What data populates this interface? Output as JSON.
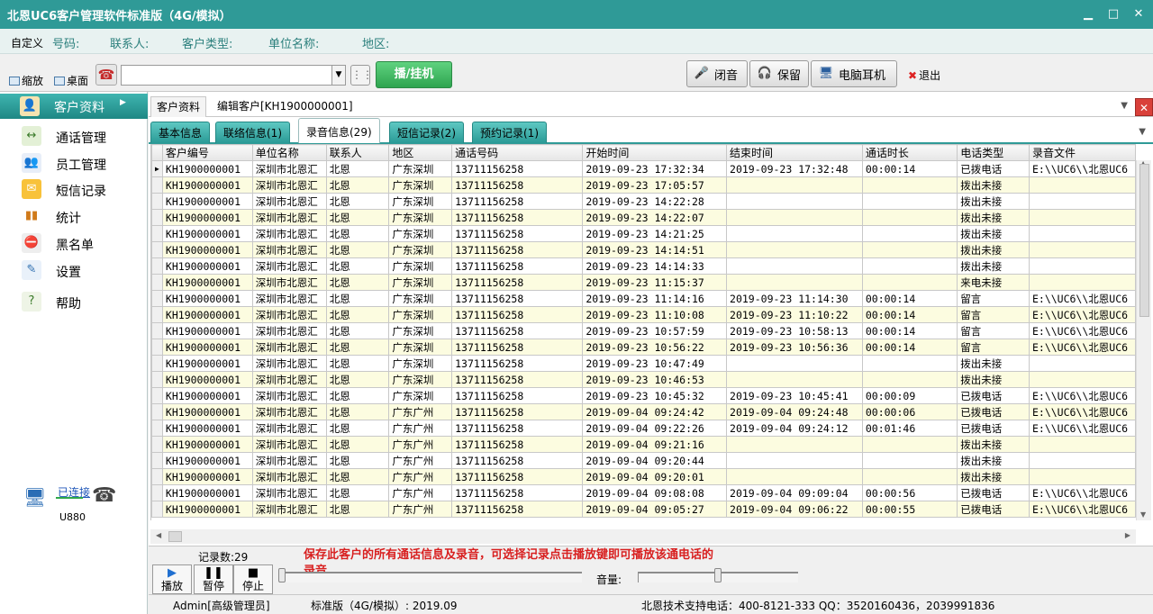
{
  "window": {
    "title": "北恩UC6客户管理软件标准版（4G/模拟）",
    "min": "▁",
    "max": "□",
    "close": "✕"
  },
  "infobar": {
    "customize": "自定义",
    "fields": [
      "号码:",
      "联系人:",
      "客户类型:",
      "单位名称:",
      "地区:"
    ]
  },
  "toolbar": {
    "zoom": "缩放",
    "desktop": "桌面",
    "phone_input_value": "",
    "dial_label": "播/挂机",
    "mute_label": "闭音",
    "hold_label": "保留",
    "headset_label": "电脑耳机",
    "exit_label": "退出"
  },
  "sidebar": {
    "items": [
      {
        "label": "客户资料",
        "icon": "contacts-icon",
        "selected": true
      },
      {
        "label": "通话管理",
        "icon": "call-manage-icon"
      },
      {
        "label": "员工管理",
        "icon": "staff-icon"
      },
      {
        "label": "短信记录",
        "icon": "sms-icon"
      },
      {
        "label": "统计",
        "icon": "stats-icon"
      },
      {
        "label": "黑名单",
        "icon": "blacklist-icon"
      },
      {
        "label": "设置",
        "icon": "settings-icon"
      },
      {
        "label": "帮助",
        "icon": "help-icon"
      }
    ],
    "connection_status": "已连接",
    "device": "U880"
  },
  "doc_tabs": [
    "客户资料",
    "编辑客户[KH1900000001]"
  ],
  "sub_tabs": [
    "基本信息",
    "联络信息(1)",
    "录音信息(29)",
    "短信记录(2)",
    "预约记录(1)"
  ],
  "grid": {
    "columns": [
      "客户编号",
      "单位名称",
      "联系人",
      "地区",
      "通话号码",
      "开始时间",
      "结束时间",
      "通话时长",
      "电话类型",
      "录音文件"
    ],
    "rows": [
      [
        "KH1900000001",
        "深圳市北恩汇",
        "北恩",
        "广东深圳",
        "13711156258",
        "2019-09-23 17:32:34",
        "2019-09-23 17:32:48",
        "00:00:14",
        "已拨电话",
        "E:\\\\UC6\\\\北恩UC6"
      ],
      [
        "KH1900000001",
        "深圳市北恩汇",
        "北恩",
        "广东深圳",
        "13711156258",
        "2019-09-23 17:05:57",
        "",
        "",
        "拨出未接",
        ""
      ],
      [
        "KH1900000001",
        "深圳市北恩汇",
        "北恩",
        "广东深圳",
        "13711156258",
        "2019-09-23 14:22:28",
        "",
        "",
        "拨出未接",
        ""
      ],
      [
        "KH1900000001",
        "深圳市北恩汇",
        "北恩",
        "广东深圳",
        "13711156258",
        "2019-09-23 14:22:07",
        "",
        "",
        "拨出未接",
        ""
      ],
      [
        "KH1900000001",
        "深圳市北恩汇",
        "北恩",
        "广东深圳",
        "13711156258",
        "2019-09-23 14:21:25",
        "",
        "",
        "拨出未接",
        ""
      ],
      [
        "KH1900000001",
        "深圳市北恩汇",
        "北恩",
        "广东深圳",
        "13711156258",
        "2019-09-23 14:14:51",
        "",
        "",
        "拨出未接",
        ""
      ],
      [
        "KH1900000001",
        "深圳市北恩汇",
        "北恩",
        "广东深圳",
        "13711156258",
        "2019-09-23 14:14:33",
        "",
        "",
        "拨出未接",
        ""
      ],
      [
        "KH1900000001",
        "深圳市北恩汇",
        "北恩",
        "广东深圳",
        "13711156258",
        "2019-09-23 11:15:37",
        "",
        "",
        "来电未接",
        ""
      ],
      [
        "KH1900000001",
        "深圳市北恩汇",
        "北恩",
        "广东深圳",
        "13711156258",
        "2019-09-23 11:14:16",
        "2019-09-23 11:14:30",
        "00:00:14",
        "留言",
        "E:\\\\UC6\\\\北恩UC6"
      ],
      [
        "KH1900000001",
        "深圳市北恩汇",
        "北恩",
        "广东深圳",
        "13711156258",
        "2019-09-23 11:10:08",
        "2019-09-23 11:10:22",
        "00:00:14",
        "留言",
        "E:\\\\UC6\\\\北恩UC6"
      ],
      [
        "KH1900000001",
        "深圳市北恩汇",
        "北恩",
        "广东深圳",
        "13711156258",
        "2019-09-23 10:57:59",
        "2019-09-23 10:58:13",
        "00:00:14",
        "留言",
        "E:\\\\UC6\\\\北恩UC6"
      ],
      [
        "KH1900000001",
        "深圳市北恩汇",
        "北恩",
        "广东深圳",
        "13711156258",
        "2019-09-23 10:56:22",
        "2019-09-23 10:56:36",
        "00:00:14",
        "留言",
        "E:\\\\UC6\\\\北恩UC6"
      ],
      [
        "KH1900000001",
        "深圳市北恩汇",
        "北恩",
        "广东深圳",
        "13711156258",
        "2019-09-23 10:47:49",
        "",
        "",
        "拨出未接",
        ""
      ],
      [
        "KH1900000001",
        "深圳市北恩汇",
        "北恩",
        "广东深圳",
        "13711156258",
        "2019-09-23 10:46:53",
        "",
        "",
        "拨出未接",
        ""
      ],
      [
        "KH1900000001",
        "深圳市北恩汇",
        "北恩",
        "广东深圳",
        "13711156258",
        "2019-09-23 10:45:32",
        "2019-09-23 10:45:41",
        "00:00:09",
        "已拨电话",
        "E:\\\\UC6\\\\北恩UC6"
      ],
      [
        "KH1900000001",
        "深圳市北恩汇",
        "北恩",
        "广东广州",
        "13711156258",
        "2019-09-04 09:24:42",
        "2019-09-04 09:24:48",
        "00:00:06",
        "已拨电话",
        "E:\\\\UC6\\\\北恩UC6"
      ],
      [
        "KH1900000001",
        "深圳市北恩汇",
        "北恩",
        "广东广州",
        "13711156258",
        "2019-09-04 09:22:26",
        "2019-09-04 09:24:12",
        "00:01:46",
        "已拨电话",
        "E:\\\\UC6\\\\北恩UC6"
      ],
      [
        "KH1900000001",
        "深圳市北恩汇",
        "北恩",
        "广东广州",
        "13711156258",
        "2019-09-04 09:21:16",
        "",
        "",
        "拨出未接",
        ""
      ],
      [
        "KH1900000001",
        "深圳市北恩汇",
        "北恩",
        "广东广州",
        "13711156258",
        "2019-09-04 09:20:44",
        "",
        "",
        "拨出未接",
        ""
      ],
      [
        "KH1900000001",
        "深圳市北恩汇",
        "北恩",
        "广东广州",
        "13711156258",
        "2019-09-04 09:20:01",
        "",
        "",
        "拨出未接",
        ""
      ],
      [
        "KH1900000001",
        "深圳市北恩汇",
        "北恩",
        "广东广州",
        "13711156258",
        "2019-09-04 09:08:08",
        "2019-09-04 09:09:04",
        "00:00:56",
        "已拨电话",
        "E:\\\\UC6\\\\北恩UC6"
      ],
      [
        "KH1900000001",
        "深圳市北恩汇",
        "北恩",
        "广东广州",
        "13711156258",
        "2019-09-04 09:05:27",
        "2019-09-04 09:06:22",
        "00:00:55",
        "已拨电话",
        "E:\\\\UC6\\\\北恩UC6"
      ]
    ]
  },
  "player": {
    "record_count": "记录数:29",
    "notice": "保存此客户的所有通话信息及录音，可选择记录点击播放键即可播放该通电话的录音",
    "play": "播放",
    "pause": "暂停",
    "stop": "停止",
    "volume_label": "音量:"
  },
  "statusbar": {
    "user": "Admin[高级管理员]",
    "version": "标准版（4G/模拟）: 2019.09",
    "support": "北恩技术支持电话：400-8121-333  QQ：3520160436，2039991836"
  },
  "colors": {
    "accent": "#2f9a97",
    "notice": "#d82020",
    "row_alt": "#fcfce0"
  }
}
